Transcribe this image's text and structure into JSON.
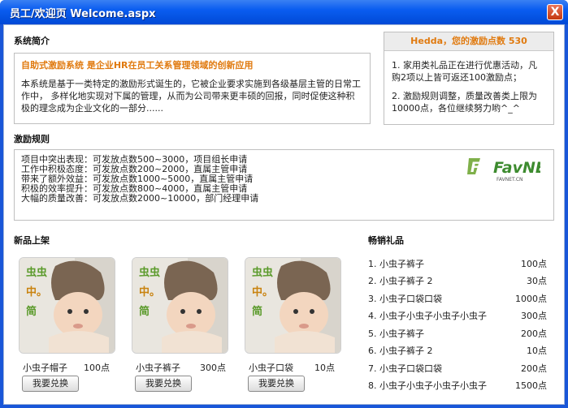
{
  "window": {
    "title": "员工/欢迎页 Welcome.aspx",
    "close_label": "X"
  },
  "intro": {
    "section_title": "系统简介",
    "headline": "自助式激励系统 是企业HR在员工关系管理领域的创新应用",
    "body": "本系统是基于一类特定的激励形式诞生的，它被企业要求实施到各级基层主管的日常工作中， 多样化地实现对下属的管理，从而为公司带来更丰硕的回报，同时促使这种积极的理念成为企业文化的一部分......"
  },
  "hedda": {
    "header": "Hedda，您的激励点数 530",
    "items": [
      "1. 家用类礼品正在进行优惠活动，凡购2项以上皆可返还100激励点；",
      "2. 激励规则调整，质量改善类上限为10000点，各位继续努力哟^_^"
    ]
  },
  "rules": {
    "section_title": "激励规则",
    "lines": [
      "项目中突出表现：可发放点数500~3000，项目组长申请",
      "工作中积极态度：可发放点数200~2000，直属主管申请",
      "带来了额外效益：可发放点数1000~5000，直属主管申请",
      "积极的效率提升：可发放点数800~4000，直属主管申请",
      "大幅的质量改善：可发放点数2000~10000，部门经理申请"
    ],
    "logo_text": "FavNET",
    "logo_sub": "FAVNET.CN"
  },
  "new_products": {
    "section_title": "新品上架",
    "image_caption": "虫虫中。简",
    "items": [
      {
        "name": "小虫子帽子",
        "points": "100点",
        "button": "我要兑换"
      },
      {
        "name": "小虫子裤子",
        "points": "300点",
        "button": "我要兑换"
      },
      {
        "name": "小虫子口袋",
        "points": "10点",
        "button": "我要兑换"
      }
    ]
  },
  "best_sellers": {
    "section_title": "畅销礼品",
    "items": [
      {
        "name": "1. 小虫子裤子",
        "points": "100点"
      },
      {
        "name": "2. 小虫子裤子 2",
        "points": "30点"
      },
      {
        "name": "3. 小虫子口袋口袋",
        "points": "1000点"
      },
      {
        "name": "4. 小虫子小虫子小虫子小虫子",
        "points": "300点"
      },
      {
        "name": "5. 小虫子裤子",
        "points": "200点"
      },
      {
        "name": "6. 小虫子裤子 2",
        "points": "10点"
      },
      {
        "name": "7. 小虫子口袋口袋",
        "points": "200点"
      },
      {
        "name": "8. 小虫子小虫子小虫子小虫子",
        "points": "1500点"
      }
    ]
  },
  "colors": {
    "accent": "#e07a0f",
    "titlebar": "#0a5df0",
    "border": "#bfbfbf",
    "logo_green": "#3d8b2f"
  }
}
